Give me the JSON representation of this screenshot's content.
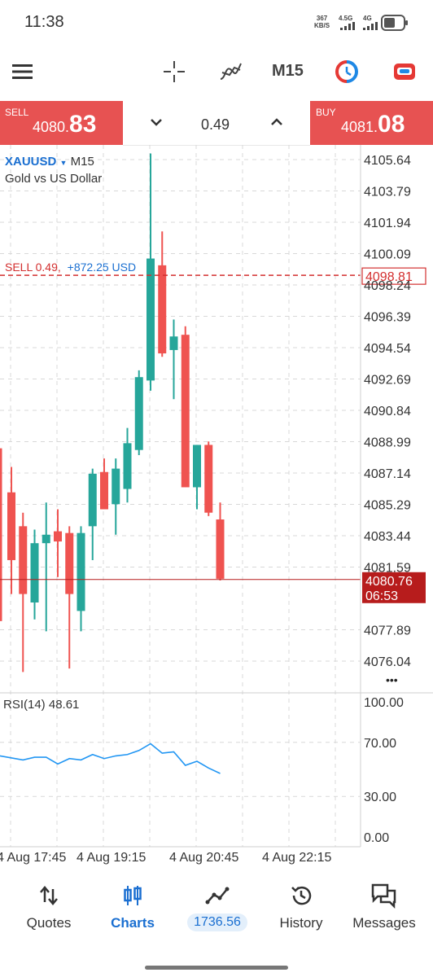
{
  "status_bar": {
    "time": "11:38",
    "net_speed_value": "367",
    "net_speed_unit": "KB/S",
    "signal1": "4.5G",
    "signal2": "4G"
  },
  "toolbar": {
    "timeframe": "M15"
  },
  "trade": {
    "sell_label": "SELL",
    "sell_price_prefix": "4080.",
    "sell_price_suffix": "83",
    "volume": "0.49",
    "buy_label": "BUY",
    "buy_price_prefix": "4081.",
    "buy_price_suffix": "08"
  },
  "chart": {
    "symbol": "XAUUSD",
    "timeframe": "M15",
    "description": "Gold vs US Dollar",
    "position_type": "SELL 0.49,",
    "position_profit": "+872.25 USD",
    "position_price": "4098.81",
    "current_price": "4080.76",
    "countdown": "06:53",
    "menu_dots": "•••",
    "colors": {
      "bull": "#26a69a",
      "bear": "#ef5350",
      "sell": "#d32f2f",
      "current": "#b71c1c",
      "rsi": "#2196f3"
    }
  },
  "chart_data": {
    "type": "candlestick",
    "y_ticks": [
      "4105.64",
      "4103.79",
      "4101.94",
      "4100.09",
      "4098.24",
      "4096.39",
      "4094.54",
      "4092.69",
      "4090.84",
      "4088.99",
      "4087.14",
      "4085.29",
      "4083.44",
      "4081.59",
      "4077.89",
      "4076.04"
    ],
    "ylim": [
      4075,
      4107
    ],
    "x_labels": [
      "4 Aug 17:45",
      "4 Aug 19:15",
      "4 Aug 20:45",
      "4 Aug 22:15"
    ],
    "candles": [
      {
        "o": 4086.0,
        "h": 4087.5,
        "l": 4080.0,
        "c": 4082.0
      },
      {
        "o": 4084.0,
        "h": 4084.8,
        "l": 4075.4,
        "c": 4080.0
      },
      {
        "o": 4079.5,
        "h": 4083.8,
        "l": 4078.5,
        "c": 4083.0
      },
      {
        "o": 4083.0,
        "h": 4085.4,
        "l": 4077.8,
        "c": 4083.5
      },
      {
        "o": 4083.7,
        "h": 4085.0,
        "l": 4081.0,
        "c": 4083.1
      },
      {
        "o": 4083.6,
        "h": 4084.0,
        "l": 4075.6,
        "c": 4080.0
      },
      {
        "o": 4079.0,
        "h": 4084.0,
        "l": 4077.8,
        "c": 4083.6
      },
      {
        "o": 4084.0,
        "h": 4087.4,
        "l": 4082.0,
        "c": 4087.1
      },
      {
        "o": 4087.2,
        "h": 4088.0,
        "l": 4085.2,
        "c": 4085.0
      },
      {
        "o": 4085.3,
        "h": 4088.0,
        "l": 4083.5,
        "c": 4087.4
      },
      {
        "o": 4086.2,
        "h": 4089.8,
        "l": 4085.4,
        "c": 4088.9
      },
      {
        "o": 4088.5,
        "h": 4093.2,
        "l": 4088.2,
        "c": 4092.8
      },
      {
        "o": 4092.6,
        "h": 4106.0,
        "l": 4092.0,
        "c": 4099.8
      },
      {
        "o": 4099.4,
        "h": 4101.4,
        "l": 4094.0,
        "c": 4094.2
      },
      {
        "o": 4094.4,
        "h": 4096.2,
        "l": 4091.5,
        "c": 4095.2
      },
      {
        "o": 4095.3,
        "h": 4095.8,
        "l": 4086.3,
        "c": 4086.3
      },
      {
        "o": 4086.3,
        "h": 4088.8,
        "l": 4085.0,
        "c": 4088.8
      },
      {
        "o": 4088.8,
        "h": 4089.0,
        "l": 4084.6,
        "c": 4084.8
      },
      {
        "o": 4084.4,
        "h": 4085.4,
        "l": 4080.8,
        "c": 4080.9
      }
    ],
    "rsi": {
      "label": "RSI(14) 48.61",
      "y_ticks": [
        "100.00",
        "70.00",
        "30.00",
        "0.00"
      ],
      "ylim": [
        0,
        100
      ],
      "values": [
        60,
        57,
        59,
        59,
        54,
        58,
        57,
        61,
        58,
        60,
        61,
        64,
        69,
        62,
        63,
        53,
        56,
        51,
        47
      ]
    }
  },
  "nav": {
    "items": [
      {
        "label": "Quotes"
      },
      {
        "label": "Charts"
      },
      {
        "label": ""
      },
      {
        "label": "History"
      },
      {
        "label": "Messages"
      }
    ],
    "balance": "1736.56"
  }
}
